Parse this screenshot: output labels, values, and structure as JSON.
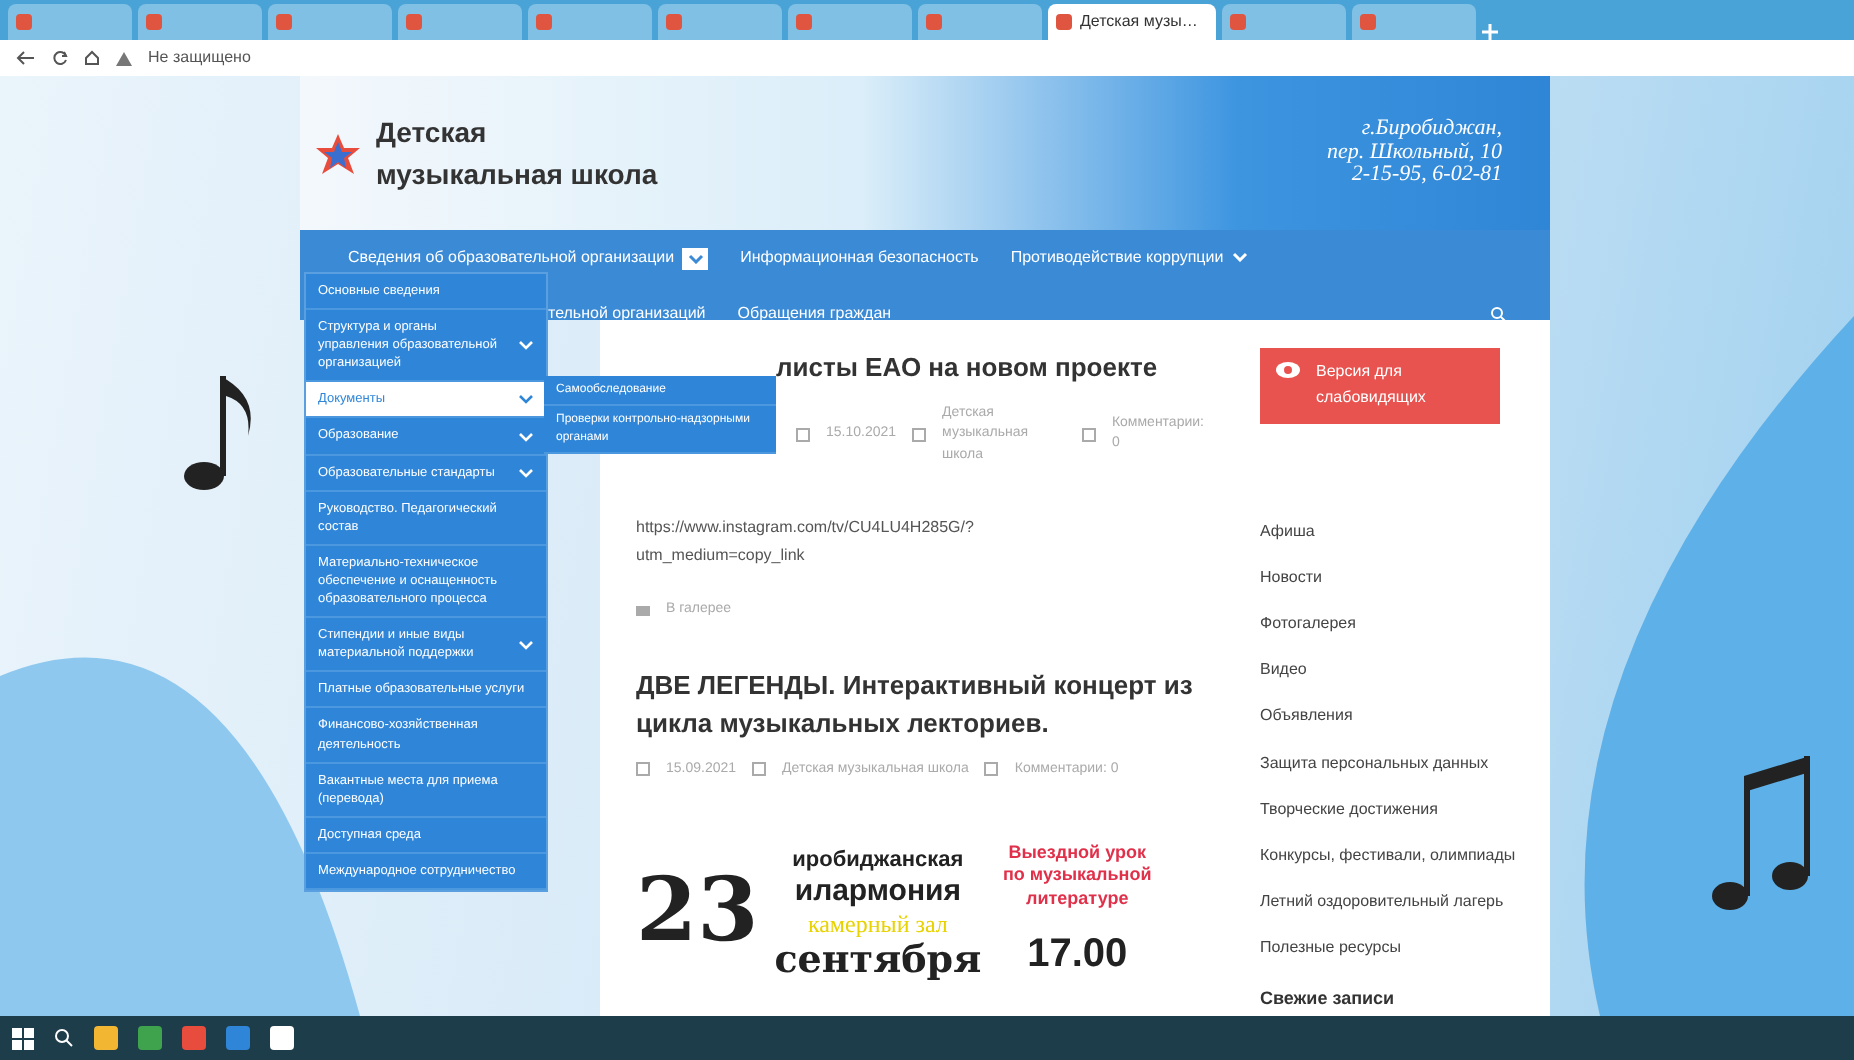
{
  "browser": {
    "tabs": [
      {
        "selected": false
      },
      {
        "selected": false
      },
      {
        "selected": false
      },
      {
        "selected": false
      },
      {
        "selected": false
      },
      {
        "selected": false
      },
      {
        "selected": false
      },
      {
        "selected": false
      },
      {
        "label": "Детская музы…",
        "selected": true
      },
      {
        "selected": false
      },
      {
        "selected": false
      }
    ],
    "address": {
      "security": "Не защищено"
    }
  },
  "header": {
    "title": "Детская музыкальная школа",
    "address_lines": [
      "г.Биробиджан,",
      "пер. Школьный, 10",
      "2-15-95, 6-02-81"
    ]
  },
  "nav": {
    "row1": [
      {
        "label": "Сведения об образовательной организации",
        "has_children": true,
        "expanded": true
      },
      {
        "label": "Информационная безопасность",
        "has_children": false
      },
      {
        "label": "Противодействие коррупции",
        "has_children": true,
        "expanded": false
      }
    ],
    "row2": [
      "тельной организаций",
      "Обращения граждан"
    ]
  },
  "dropdown": [
    {
      "label": "Основные сведения",
      "has_children": false,
      "selected": false
    },
    {
      "label": "Структура и органы управления образовательной организацией",
      "has_children": true,
      "selected": false
    },
    {
      "label": "Документы",
      "has_children": true,
      "selected": true
    },
    {
      "label": "Образование",
      "has_children": true,
      "selected": false
    },
    {
      "label": "Образовательные стандарты",
      "has_children": true,
      "selected": false
    },
    {
      "label": "Руководство. Педагогический состав",
      "has_children": false,
      "selected": false
    },
    {
      "label": "Материально-техническое обеспечение и оснащенность образовательного процесса",
      "has_children": false,
      "selected": false
    },
    {
      "label": "Стипендии и иные виды материальной поддержки",
      "has_children": true,
      "selected": false
    },
    {
      "label": "Платные образовательные услуги",
      "has_children": false,
      "selected": false
    },
    {
      "label": "Финансово-хозяйственная деятельность",
      "has_children": false,
      "selected": false
    },
    {
      "label": "Вакантные места для приема (перевода)",
      "has_children": false,
      "selected": false
    },
    {
      "label": "Доступная среда",
      "has_children": false,
      "selected": false
    },
    {
      "label": "Международное сотрудничество",
      "has_children": false,
      "selected": false
    }
  ],
  "submenu": [
    "Самообследование",
    "Проверки контрольно-надзорными органами"
  ],
  "posts": [
    {
      "title": "листы ЕАО на новом проекте",
      "meta": [
        "15.10.2021",
        "Детская музыкальная школа",
        "Комментарии: 0"
      ],
      "body": [
        "https://www.instagram.com/tv/CU4LU4H285G/?",
        "utm_medium=copy_link"
      ],
      "category": "В галерее"
    },
    {
      "title": "ДВЕ ЛЕГЕНДЫ. Интерактивный концерт из цикла музыкальных лекториев.",
      "meta": [
        "15.09.2021",
        "Детская музыкальная школа",
        "Комментарии: 0"
      ],
      "poster": {
        "org_top": "иробиджанская",
        "org_bottom": "илармония",
        "day": "23",
        "hall": "камерный зал",
        "month": "сентября",
        "lesson": "Выездной урок по музыкальной литературе",
        "time": "17.00"
      }
    }
  ],
  "sidebar": {
    "accessibility_button": "Версия для слабовидящих",
    "links": [
      "Афиша",
      "Новости",
      "Фотогалерея",
      "Видео",
      "Объявления",
      "Защита персональных данных",
      "Творческие достижения",
      "Конкурсы, фестивали, олимпиады",
      "Летний оздоровительный лагерь",
      "Полезные ресурсы"
    ],
    "recent_heading": "Свежие записи"
  }
}
